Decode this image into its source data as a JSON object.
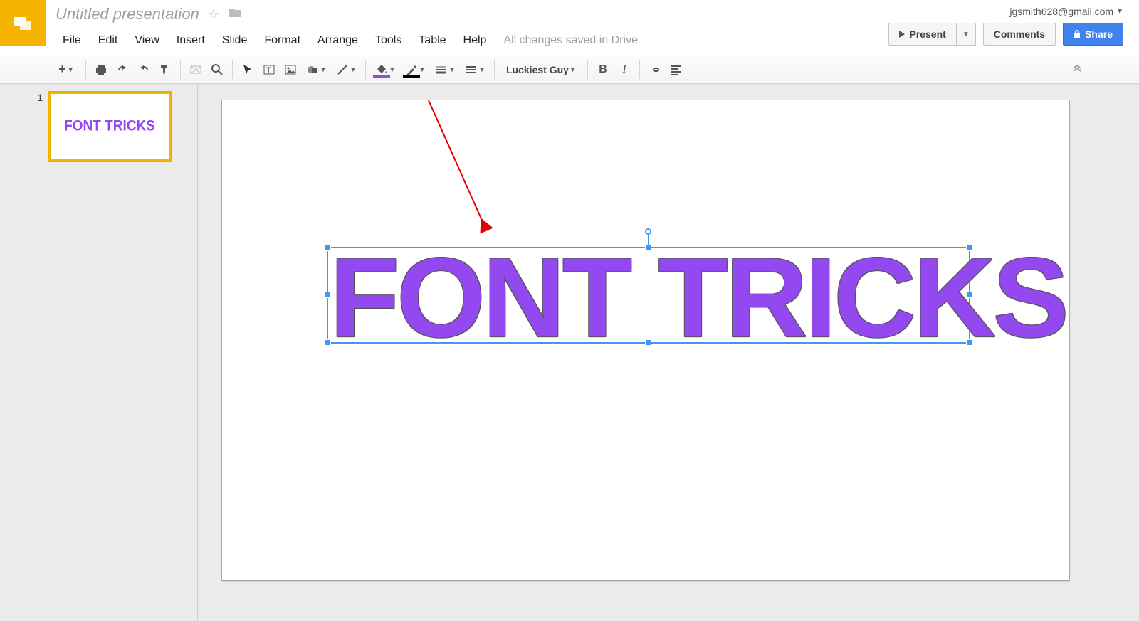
{
  "header": {
    "doc_title": "Untitled presentation",
    "save_status": "All changes saved in Drive",
    "account": "jgsmith628@gmail.com",
    "menus": [
      "File",
      "Edit",
      "View",
      "Insert",
      "Slide",
      "Format",
      "Arrange",
      "Tools",
      "Table",
      "Help"
    ],
    "present_label": "Present",
    "comments_label": "Comments",
    "share_label": "Share"
  },
  "toolbar": {
    "font": "Luckiest Guy",
    "fill_color": "#9448ef",
    "line_color": "#000000"
  },
  "slides": {
    "count": 1,
    "items": [
      {
        "number": "1",
        "title": "FONT TRICKS"
      }
    ]
  },
  "canvas": {
    "textbox_text": "FONT TRICKS",
    "text_color": "#9448ef"
  }
}
